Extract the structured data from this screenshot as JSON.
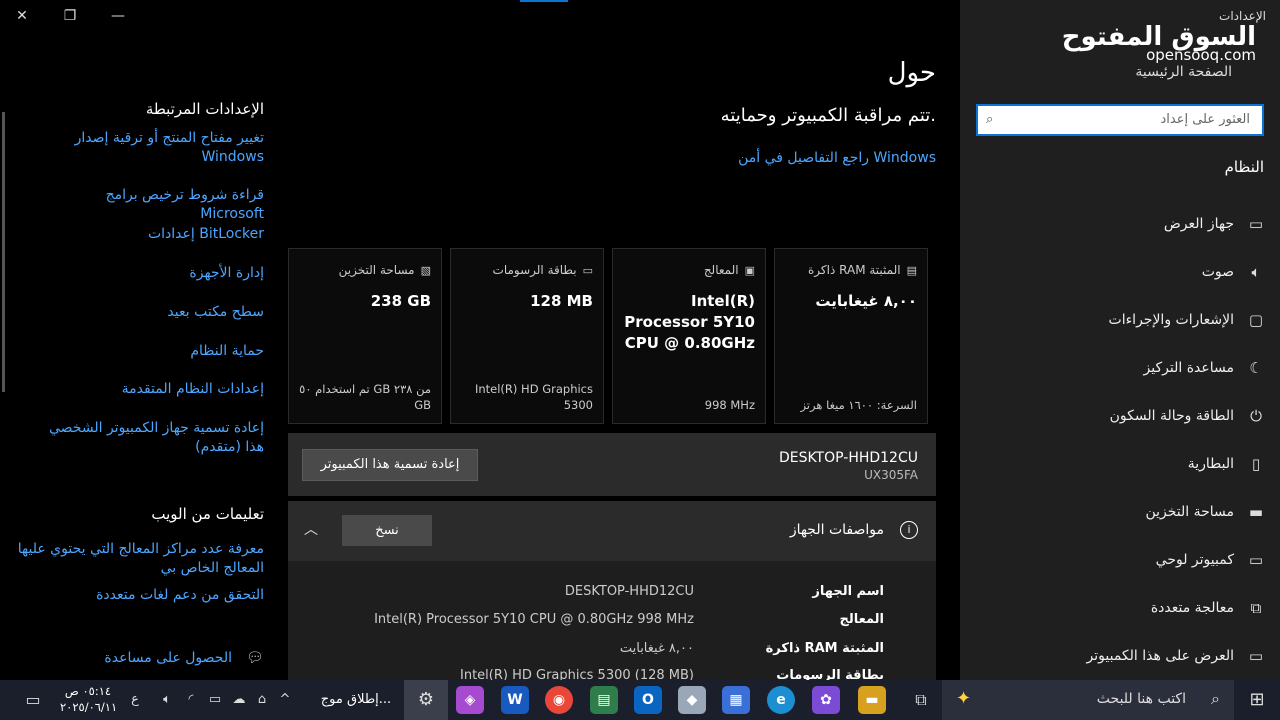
{
  "window": {
    "close_glyph": "✕",
    "restore_glyph": "❐",
    "minimize_glyph": "—"
  },
  "nav": {
    "app_title": "الإعدادات",
    "logo_ar": "السوق المفتوح",
    "logo_en": "opensooq.com",
    "home": "الصفحة الرئيسية",
    "search_placeholder": "العثور على إعداد",
    "section": "النظام",
    "items": [
      {
        "label": "جهاز العرض",
        "icon": "display-icon"
      },
      {
        "label": "صوت",
        "icon": "speaker-icon"
      },
      {
        "label": "الإشعارات والإجراءات",
        "icon": "notification-icon"
      },
      {
        "label": "مساعدة التركيز",
        "icon": "moon-icon"
      },
      {
        "label": "الطاقة وحالة السكون",
        "icon": "power-icon"
      },
      {
        "label": "البطارية",
        "icon": "battery-icon"
      },
      {
        "label": "مساحة التخزين",
        "icon": "storage-icon"
      },
      {
        "label": "كمبيوتر لوحي",
        "icon": "tablet-icon"
      },
      {
        "label": "معالجة متعددة",
        "icon": "multitasking-icon"
      },
      {
        "label": "العرض على هذا الكمبيوتر",
        "icon": "project-icon"
      }
    ]
  },
  "main": {
    "title": "حول",
    "monitored": "تتم مراقبة الكمبيوتر وحمايته.",
    "security_link": "راجع التفاصيل في أمن Windows",
    "cards": [
      {
        "title": "ذاكرة RAM المثبتة",
        "value": "٨,٠٠ غيغابايت",
        "sub": "السرعة: ١٦٠٠ ميغا هرتز"
      },
      {
        "title": "المعالج",
        "value": "Intel(R) Processor 5Y10 CPU @ 0.80GHz",
        "sub": "998 MHz"
      },
      {
        "title": "بطاقة الرسومات",
        "value": "128 MB",
        "sub": "Intel(R) HD Graphics 5300"
      },
      {
        "title": "مساحة التخزين",
        "value": "238 GB",
        "sub": "تم استخدام ٥٠ GB من ٢٣٨ GB"
      }
    ],
    "pc_name": "DESKTOP-HHD12CU",
    "pc_model": "UX305FA",
    "rename_button": "إعادة تسمية هذا الكمبيوتر",
    "specs_title": "مواصفات الجهاز",
    "copy_button": "نسخ",
    "specs": [
      {
        "key": "اسم الجهاز",
        "value": "DESKTOP-HHD12CU"
      },
      {
        "key": "المعالج",
        "value": "Intel(R) Processor 5Y10 CPU @ 0.80GHz   998 MHz"
      },
      {
        "key": "ذاكرة RAM المثبتة",
        "value": "٨,٠٠ غيغابايت"
      },
      {
        "key": "بطاقة الرسومات",
        "value": "Intel(R) HD Graphics 5300 (128 MB)"
      }
    ]
  },
  "related": {
    "title": "الإعدادات المرتبطة",
    "links": [
      "تغيير مفتاح المنتج أو ترقية إصدار Windows",
      "قراءة شروط ترخيص برامج Microsoft",
      "إعدادات BitLocker",
      "إدارة الأجهزة",
      "سطح مكتب بعيد",
      "حماية النظام",
      "إعدادات النظام المتقدمة",
      "إعادة تسمية جهاز الكمبيوتر الشخصي هذا (متقدم)"
    ],
    "web_title": "تعليمات من الويب",
    "web_links": [
      "معرفة عدد مراكز المعالج التي يحتوي عليها المعالج الخاص بي",
      "التحقق من دعم لغات متعددة"
    ],
    "help": "الحصول على مساعدة"
  },
  "taskbar": {
    "search_placeholder": "اكتب هنا للبحث",
    "launch_label": "إطلاق موج...",
    "time": "٠٥:١٤ ص",
    "date": "٢٠٢٥/٠٦/١١",
    "lang": "ع",
    "apps": [
      "file-explorer-icon",
      "copilot-icon",
      "edge-icon",
      "store-icon",
      "outlook-icon",
      "chrome-icon",
      "word-icon",
      "m365-icon",
      "settings-icon"
    ]
  }
}
